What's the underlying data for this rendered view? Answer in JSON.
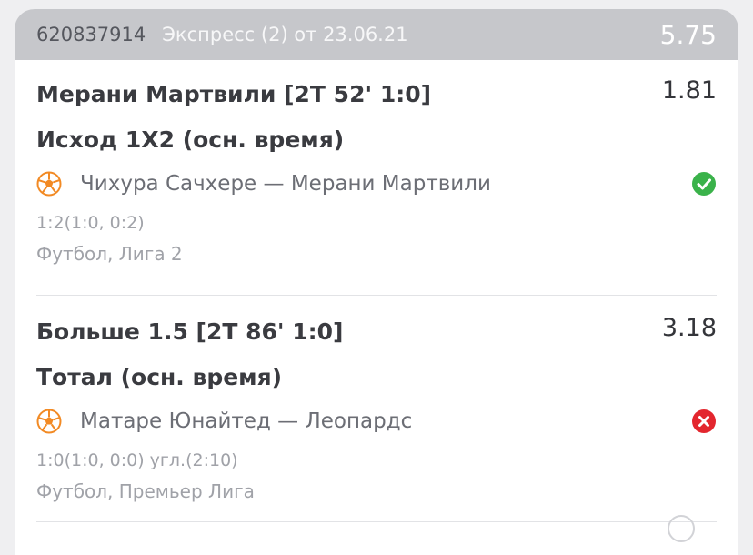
{
  "header": {
    "bet_id": "620837914",
    "title": "Экспресс (2) от 23.06.21",
    "total_odds": "5.75"
  },
  "bets": [
    {
      "selection": "Мерани Мартвили [2Т 52' 1:0]",
      "odds": "1.81",
      "market": "Исход 1Х2 (осн. время)",
      "event": "Чихура Сачхере — Мерани Мартвили",
      "score": "1:2(1:0, 0:2)",
      "league": "Футбол, Лига 2",
      "status_icon": "check-circle-icon",
      "status_color": "#3ab24a"
    },
    {
      "selection": "Больше 1.5 [2Т 86' 1:0]",
      "odds": "3.18",
      "market": "Тотал (осн. время)",
      "event": "Матаре Юнайтед — Леопардс",
      "score": "1:0(1:0, 0:0) угл.(2:10)",
      "league": "Футбол, Премьер Лига",
      "status_icon": "cross-circle-icon",
      "status_color": "#e3262e"
    }
  ],
  "sport_icon": "soccer-ball-icon"
}
